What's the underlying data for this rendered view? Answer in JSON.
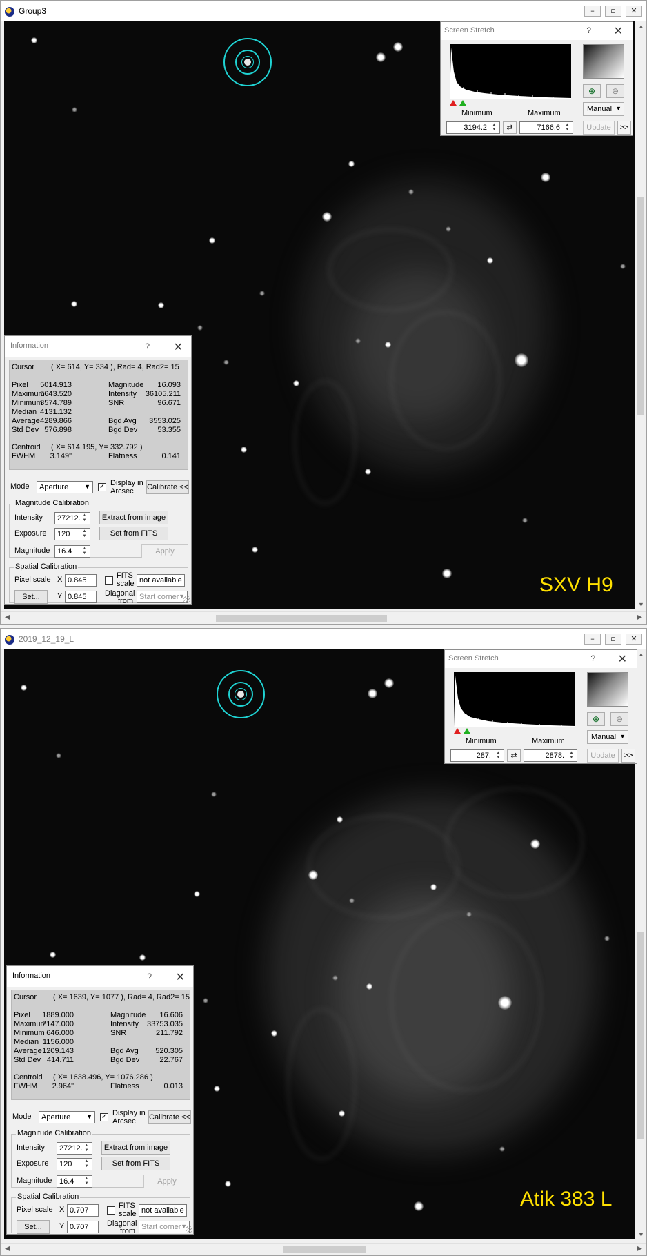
{
  "windows": [
    {
      "title": "Group3",
      "camera_label": "SXV H9",
      "stretch": {
        "title": "Screen Stretch",
        "help": "?",
        "min_label": "Minimum",
        "max_label": "Maximum",
        "min_value": "3194.2",
        "max_value": "7166.6",
        "mode": "Manual",
        "update_label": "Update",
        "more_label": ">>"
      },
      "info": {
        "title": "Information",
        "help": "?",
        "cursor_label": "Cursor",
        "cursor_coords": "( X=  614, Y=  334 ), Rad=  4, Rad2= 15",
        "stats": [
          {
            "l": "Pixel",
            "v": "5014.913",
            "l2": "Magnitude",
            "v2": "16.093"
          },
          {
            "l": "Maximum",
            "v": "5643.520",
            "l2": "Intensity",
            "v2": "36105.211"
          },
          {
            "l": "Minimum",
            "v": "3574.789",
            "l2": "SNR",
            "v2": "96.671"
          },
          {
            "l": "Median",
            "v": "4131.132",
            "l2": "",
            "v2": ""
          },
          {
            "l": "Average",
            "v": "4289.866",
            "l2": "Bgd Avg",
            "v2": "3553.025"
          },
          {
            "l": "Std Dev",
            "v": "576.898",
            "l2": "Bgd Dev",
            "v2": "53.355"
          }
        ],
        "centroid_label": "Centroid",
        "centroid_coords": "( X=  614.195, Y=  332.792 )",
        "fwhm_label": "FWHM",
        "fwhm_value": "3.149\"",
        "flatness_label": "Flatness",
        "flatness_value": "0.141",
        "mode_label": "Mode",
        "mode_value": "Aperture",
        "display_arcsec_label_1": "Display in",
        "display_arcsec_label_2": "Arcsec",
        "display_arcsec_checked": "✓",
        "calibrate_label": "Calibrate <<",
        "mag_cal_legend": "Magnitude Calibration",
        "intensity_label": "Intensity",
        "intensity_value": "27212.",
        "extract_label": "Extract from image",
        "exposure_label": "Exposure",
        "exposure_value": "120",
        "set_fits_label": "Set from FITS",
        "magnitude_label": "Magnitude",
        "magnitude_value": "16.4",
        "apply_label": "Apply",
        "spatial_legend": "Spatial Calibration",
        "pixel_scale_label": "Pixel scale",
        "x_label": "X",
        "x_value": "0.845",
        "y_label": "Y",
        "y_value": "0.845",
        "fits_scale_label_1": "FITS",
        "fits_scale_label_2": "scale",
        "not_available": "not available",
        "set_label": "Set...",
        "diagonal_label_1": "Diagonal",
        "diagonal_label_2": "from",
        "start_corner": "Start corner"
      }
    },
    {
      "title": "2019_12_19_L",
      "camera_label": "Atik 383 L",
      "stretch": {
        "title": "Screen Stretch",
        "help": "?",
        "min_label": "Minimum",
        "max_label": "Maximum",
        "min_value": "287.",
        "max_value": "2878.",
        "mode": "Manual",
        "update_label": "Update",
        "more_label": ">>"
      },
      "info": {
        "title": "Information",
        "help": "?",
        "cursor_label": "Cursor",
        "cursor_coords": "( X= 1639, Y= 1077 ), Rad=  4, Rad2= 15",
        "stats": [
          {
            "l": "Pixel",
            "v": "1889.000",
            "l2": "Magnitude",
            "v2": "16.606"
          },
          {
            "l": "Maximum",
            "v": "2147.000",
            "l2": "Intensity",
            "v2": "33753.035"
          },
          {
            "l": "Minimum",
            "v": "646.000",
            "l2": "SNR",
            "v2": "211.792"
          },
          {
            "l": "Median",
            "v": "1156.000",
            "l2": "",
            "v2": ""
          },
          {
            "l": "Average",
            "v": "1209.143",
            "l2": "Bgd Avg",
            "v2": "520.305"
          },
          {
            "l": "Std Dev",
            "v": "414.711",
            "l2": "Bgd Dev",
            "v2": "22.767"
          }
        ],
        "centroid_label": "Centroid",
        "centroid_coords": "( X= 1638.496, Y= 1076.286 )",
        "fwhm_label": "FWHM",
        "fwhm_value": "2.964\"",
        "flatness_label": "Flatness",
        "flatness_value": "0.013",
        "mode_label": "Mode",
        "mode_value": "Aperture",
        "display_arcsec_label_1": "Display in",
        "display_arcsec_label_2": "Arcsec",
        "display_arcsec_checked": "✓",
        "calibrate_label": "Calibrate <<",
        "mag_cal_legend": "Magnitude Calibration",
        "intensity_label": "Intensity",
        "intensity_value": "27212.",
        "extract_label": "Extract from image",
        "exposure_label": "Exposure",
        "exposure_value": "120",
        "set_fits_label": "Set from FITS",
        "magnitude_label": "Magnitude",
        "magnitude_value": "16.4",
        "apply_label": "Apply",
        "spatial_legend": "Spatial Calibration",
        "pixel_scale_label": "Pixel scale",
        "x_label": "X",
        "x_value": "0.707",
        "y_label": "Y",
        "y_value": "0.707",
        "fits_scale_label_1": "FITS",
        "fits_scale_label_2": "scale",
        "not_available": "not available",
        "set_label": "Set...",
        "diagonal_label_1": "Diagonal",
        "diagonal_label_2": "from",
        "start_corner": "Start corner"
      }
    }
  ],
  "colors": {
    "aperture": "#1fd2d2",
    "camera_label": "#ffe000",
    "readout_bg": "#cfcfcf"
  }
}
